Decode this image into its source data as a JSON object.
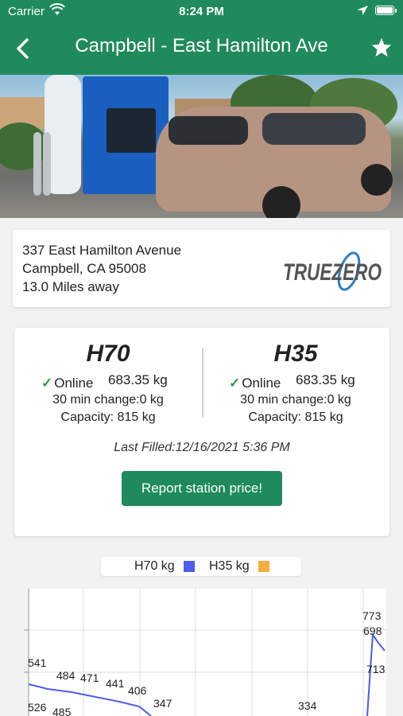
{
  "status_bar": {
    "carrier": "Carrier",
    "time": "8:24 PM"
  },
  "nav": {
    "title": "Campbell - East Hamilton Ave"
  },
  "address": {
    "street": "337 East Hamilton Avenue",
    "city": "Campbell, CA 95008",
    "distance": "13.0 Miles away",
    "logo_text": "TRUEZERO"
  },
  "stations": [
    {
      "grade": "H70",
      "status": "Online",
      "amount": "683.35 kg",
      "change": "30 min change:0 kg",
      "capacity": "Capacity: 815 kg"
    },
    {
      "grade": "H35",
      "status": "Online",
      "amount": "683.35 kg",
      "change": "30 min change:0 kg",
      "capacity": "Capacity: 815 kg"
    }
  ],
  "last_filled": "Last Filled:12/16/2021 5:36 PM",
  "report_button": "Report station price!",
  "legend": {
    "h70": "H70 kg",
    "h35": "H35 kg",
    "h70_color": "#4f5de8",
    "h35_color": "#f6ae3c"
  },
  "colors": {
    "accent": "#1f8a5b",
    "online": "#2e9b44"
  },
  "chart_data": {
    "type": "line",
    "series": [
      {
        "name": "H70 kg",
        "color": "#4f5de8",
        "points": [
          {
            "x": 0,
            "y": 541
          },
          {
            "x": 1,
            "y": 526
          },
          {
            "x": 2,
            "y": 484
          },
          {
            "x": 3,
            "y": 485
          },
          {
            "x": 4,
            "y": 471
          },
          {
            "x": 5,
            "y": 441
          },
          {
            "x": 6,
            "y": 406
          },
          {
            "x": 7,
            "y": 347
          },
          {
            "x": 8,
            "y": 334
          },
          {
            "x": 9,
            "y": 773
          },
          {
            "x": 10,
            "y": 698
          },
          {
            "x": 11,
            "y": 713
          }
        ]
      }
    ],
    "data_labels": [
      "541",
      "526",
      "484",
      "485",
      "471",
      "441",
      "406",
      "347",
      "334",
      "773",
      "698",
      "713"
    ],
    "grid": true
  }
}
